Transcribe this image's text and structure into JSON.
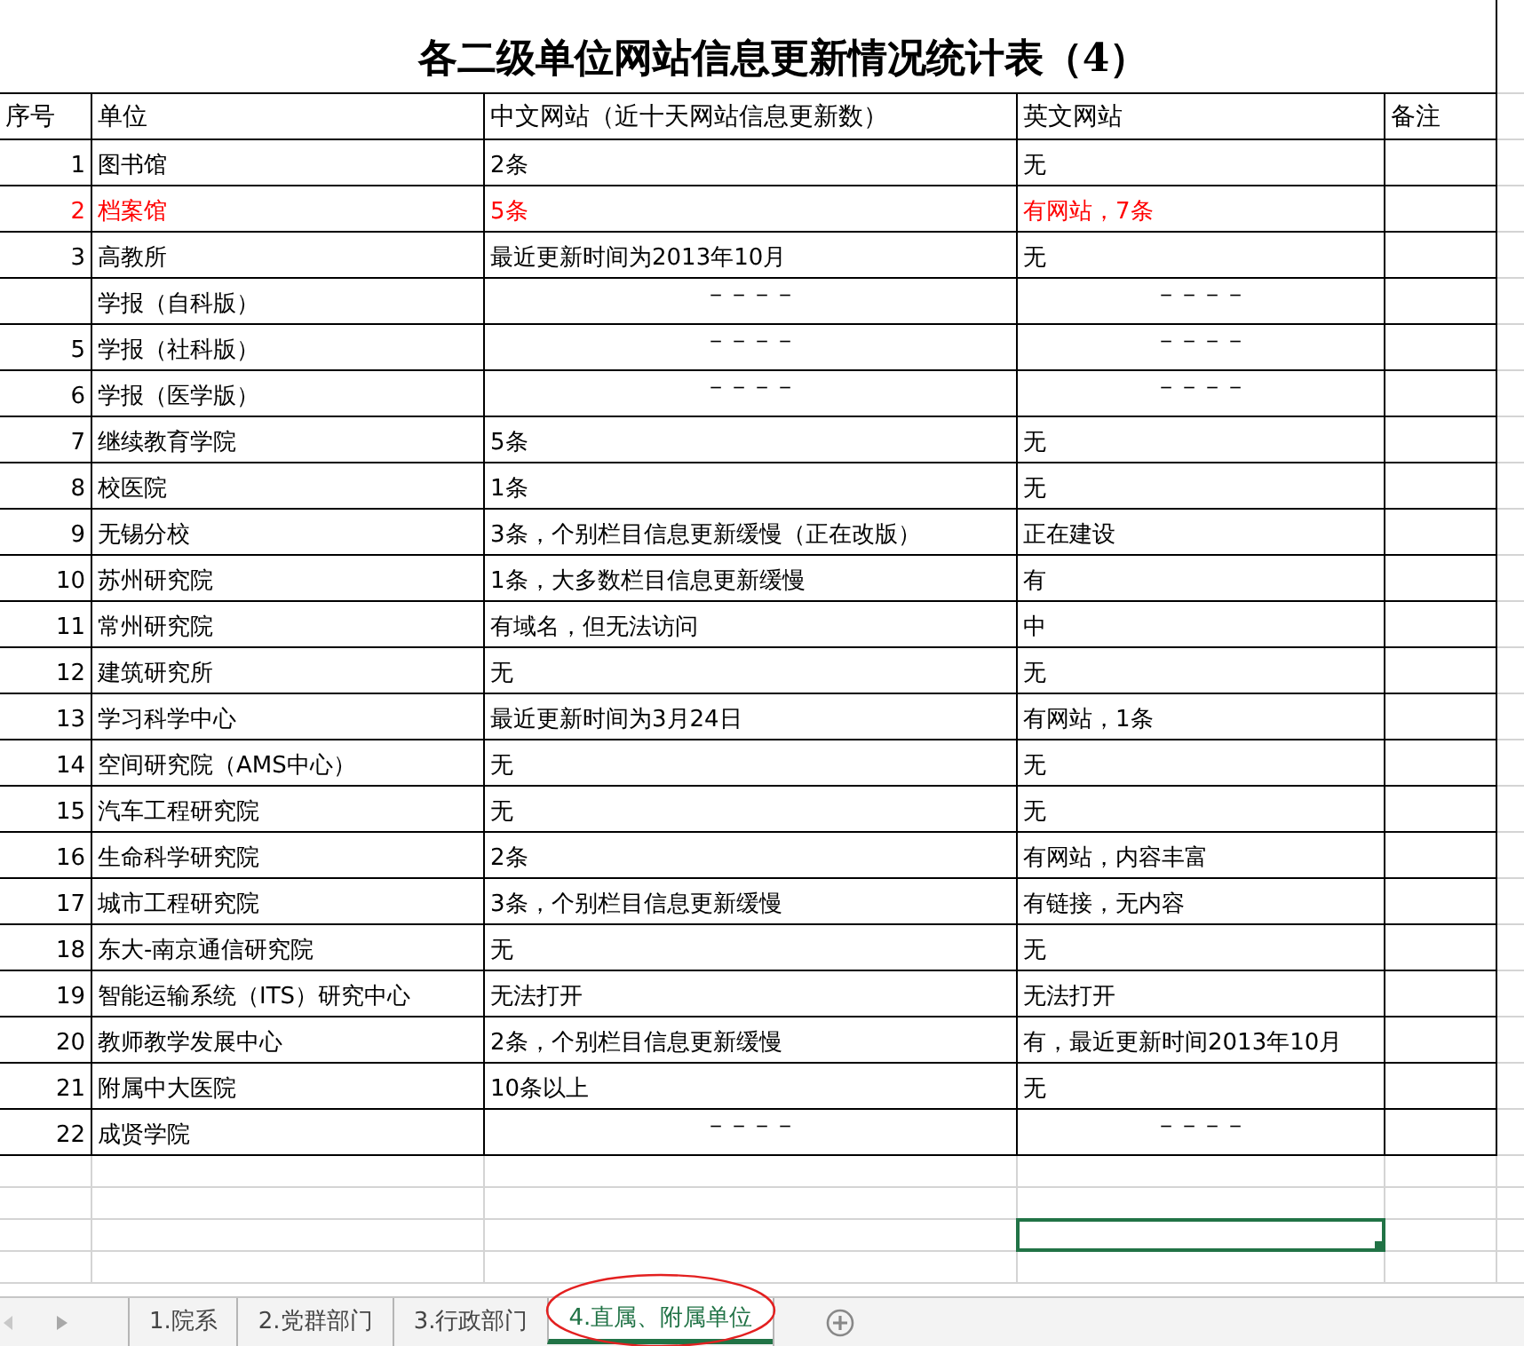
{
  "title": "各二级单位网站信息更新情况统计表（4）",
  "columns": [
    "序号",
    "单位",
    "中文网站（近十天网站信息更新数）",
    "英文网站",
    "备注"
  ],
  "rows": [
    {
      "kind": "entry",
      "number": "1",
      "unit": "图书馆",
      "cn": "2条",
      "en": "无",
      "flagged": false
    },
    {
      "kind": "entry",
      "number": "2",
      "unit": "档案馆",
      "cn": "5条",
      "en": "有网站，7条",
      "flagged": true
    },
    {
      "kind": "entry",
      "number": "3",
      "unit": "高教所",
      "cn": "最近更新时间为2013年10月",
      "en": "无",
      "flagged": false
    },
    {
      "kind": "dashes",
      "unit": "学报（自科版）",
      "cn": "－－－－",
      "en": "－－－－",
      "flagged": false
    },
    {
      "kind": "dashes",
      "number": "5",
      "unit": "学报（社科版）",
      "cn": "－－－－",
      "en": "－－－－",
      "flagged": false
    },
    {
      "kind": "dashes",
      "number": "6",
      "unit": "学报（医学版）",
      "cn": "－－－－",
      "en": "－－－－",
      "flagged": false
    },
    {
      "kind": "entry",
      "number": "7",
      "unit": "继续教育学院",
      "cn": "5条",
      "en": "无",
      "flagged": false
    },
    {
      "kind": "entry",
      "number": "8",
      "unit": "校医院",
      "cn": "1条",
      "en": "无",
      "flagged": false
    },
    {
      "kind": "entry",
      "number": "9",
      "unit": "无锡分校",
      "cn": "3条，个别栏目信息更新缓慢（正在改版）",
      "en": "正在建设",
      "flagged": false
    },
    {
      "kind": "entry",
      "number": "10",
      "unit": "苏州研究院",
      "cn": "1条，大多数栏目信息更新缓慢",
      "en": "有",
      "flagged": false
    },
    {
      "kind": "entry",
      "number": "11",
      "unit": "常州研究院",
      "cn": "有域名，但无法访问",
      "en": "中",
      "flagged": false
    },
    {
      "kind": "entry",
      "number": "12",
      "unit": "建筑研究所",
      "cn": "无",
      "en": "无",
      "flagged": false
    },
    {
      "kind": "entry",
      "number": "13",
      "unit": "学习科学中心",
      "cn": "最近更新时间为3月24日",
      "en": "有网站，1条",
      "flagged": false
    },
    {
      "kind": "entry",
      "number": "14",
      "unit": "空间研究院（AMS中心）",
      "cn": "无",
      "en": "无",
      "flagged": false
    },
    {
      "kind": "entry",
      "number": "15",
      "unit": "汽车工程研究院",
      "cn": "无",
      "en": "无",
      "flagged": false
    },
    {
      "kind": "entry",
      "number": "16",
      "unit": "生命科学研究院",
      "cn": "2条",
      "en": "有网站，内容丰富",
      "flagged": false
    },
    {
      "kind": "entry",
      "number": "17",
      "unit": "城市工程研究院",
      "cn": "3条，个别栏目信息更新缓慢",
      "en": "有链接，无内容",
      "flagged": false
    },
    {
      "kind": "entry",
      "number": "18",
      "unit": "东大-南京通信研究院",
      "cn": "无",
      "en": "无",
      "flagged": false
    },
    {
      "kind": "entry",
      "number": "19",
      "unit": "智能运输系统（ITS）研究中心",
      "cn": "无法打开",
      "en": "无法打开",
      "flagged": false
    },
    {
      "kind": "entry",
      "number": "20",
      "unit": "教师教学发展中心",
      "cn": "2条，个别栏目信息更新缓慢",
      "en": "有，最近更新时间2013年10月",
      "flagged": false
    },
    {
      "kind": "entry",
      "number": "21",
      "unit": "附属中大医院",
      "cn": "10条以上",
      "en": "无",
      "flagged": false
    },
    {
      "kind": "dashes",
      "number": "22",
      "unit": "成贤学院",
      "cn": "－－－－",
      "en": "－－－－",
      "flagged": false
    }
  ],
  "blank_rows": [
    {
      "selected": false
    },
    {
      "selected": false
    },
    {
      "selected": true
    },
    {
      "selected": false
    }
  ],
  "sheet_tabs": [
    {
      "label": "1.院系",
      "selected": false
    },
    {
      "label": "2.党群部门",
      "selected": false
    },
    {
      "label": "3.行政部门",
      "selected": false
    },
    {
      "label": "4.直属、附属单位",
      "selected": true,
      "circled": true
    }
  ]
}
